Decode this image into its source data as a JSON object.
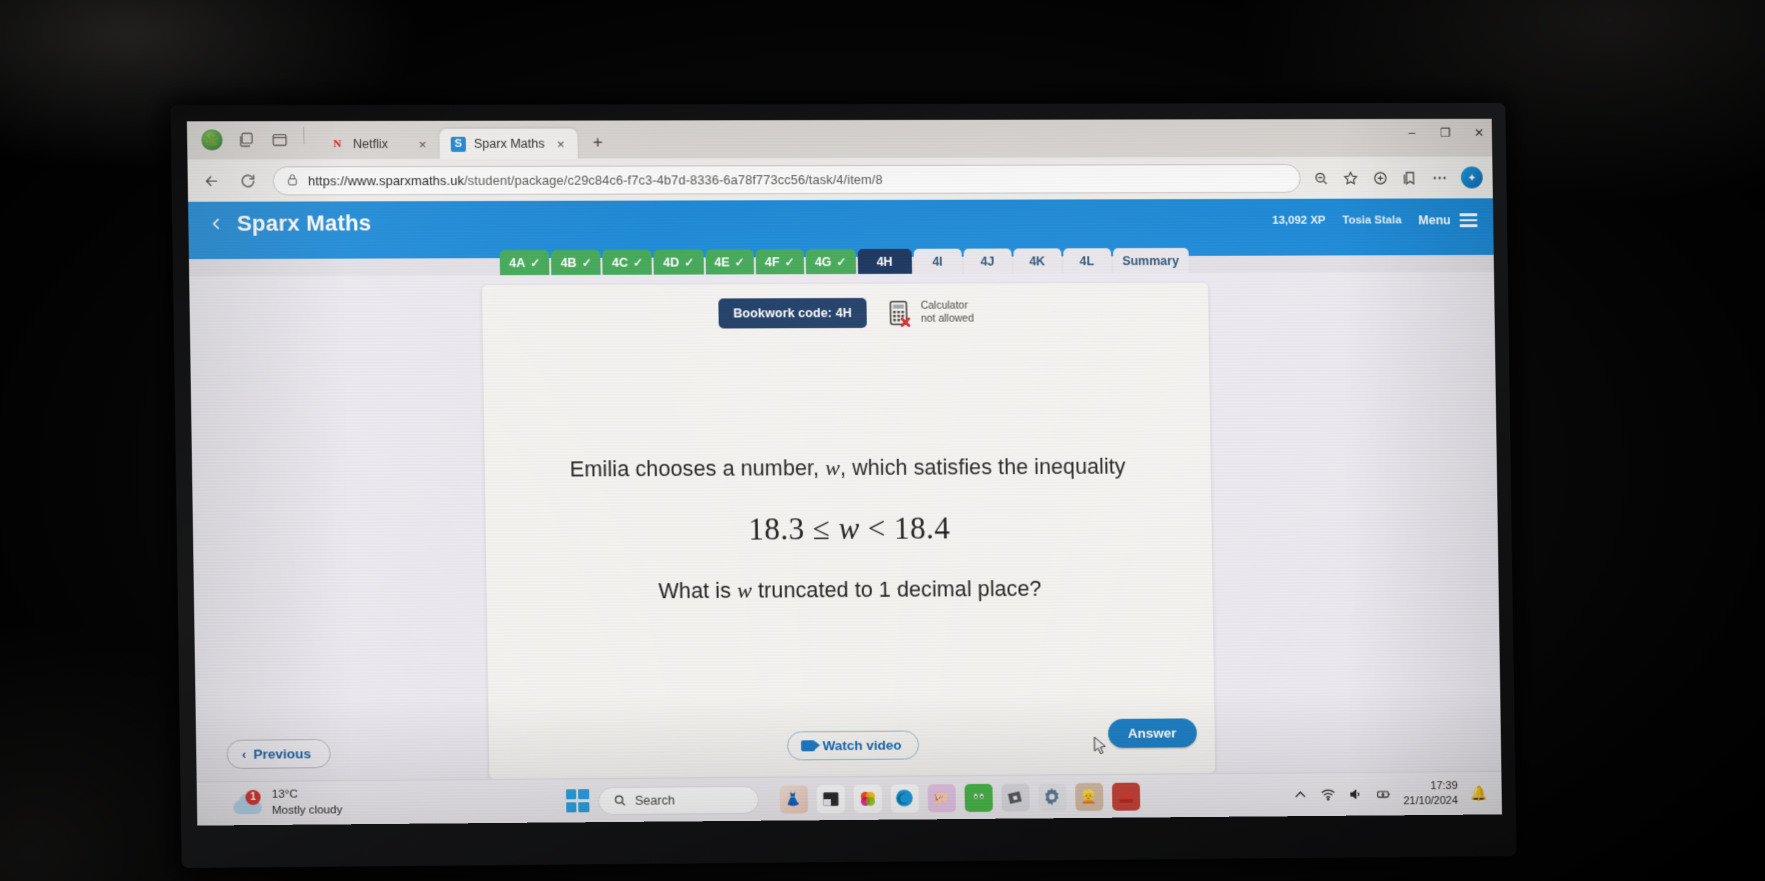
{
  "browser": {
    "tabs": [
      {
        "title": "Netflix",
        "favicon": "netflix-icon",
        "active": false,
        "close_label": "×"
      },
      {
        "title": "Sparx Maths",
        "favicon": "sparx-icon",
        "active": true,
        "close_label": "×"
      }
    ],
    "new_tab_label": "+",
    "window_controls": {
      "minimize": "–",
      "maximize": "❐",
      "close": "✕"
    },
    "address": {
      "protocol_host": "https://www.sparxmaths.uk",
      "path": "/student/package/c29c84c6-f7c3-4b7d-8336-6a78f773cc56/task/4/item/8",
      "full_url": "https://www.sparxmaths.uk/student/package/c29c84c6-f7c3-4b7d-8336-6a78f773cc56/task/4/item/8"
    },
    "toolbar_icons": [
      "back-icon",
      "reload-icon",
      "lock-icon",
      "zoom-out-icon",
      "favorite-star-icon",
      "collections-icon",
      "favorites-bar-icon",
      "settings-more-icon",
      "copilot-icon"
    ]
  },
  "sparx": {
    "header": {
      "title": "Sparx Maths",
      "back_icon": "chevron-left-icon",
      "xp": "13,092 XP",
      "user": "Tosia Stala",
      "menu_label": "Menu",
      "menu_icon": "hamburger-icon",
      "brand_color": "#1c8ad8"
    },
    "task_tabs": [
      {
        "label": "4A",
        "state": "done"
      },
      {
        "label": "4B",
        "state": "done"
      },
      {
        "label": "4C",
        "state": "done"
      },
      {
        "label": "4D",
        "state": "done"
      },
      {
        "label": "4E",
        "state": "done"
      },
      {
        "label": "4F",
        "state": "done"
      },
      {
        "label": "4G",
        "state": "done"
      },
      {
        "label": "4H",
        "state": "current"
      },
      {
        "label": "4I",
        "state": "todo"
      },
      {
        "label": "4J",
        "state": "todo"
      },
      {
        "label": "4K",
        "state": "todo"
      },
      {
        "label": "4L",
        "state": "todo"
      },
      {
        "label": "Summary",
        "state": "todo"
      }
    ],
    "tick_glyph": "✓",
    "card": {
      "bookwork_code": "Bookwork code: 4H",
      "calculator_icon": "calculator-not-allowed-icon",
      "calculator_line1": "Calculator",
      "calculator_line2": "not allowed",
      "question_line1_before": "Emilia chooses a number, ",
      "question_line1_var": "w",
      "question_line1_after": ", which satisfies the inequality",
      "math_left": "18.3 ≤ ",
      "math_var": "w",
      "math_right": " < 18.4",
      "question_line2_before": "What is ",
      "question_line2_var": "w",
      "question_line2_after": " truncated to 1 decimal place?",
      "watch_video_label": "Watch video",
      "watch_video_icon": "video-camera-icon",
      "answer_label": "Answer",
      "previous_label": "Previous",
      "previous_icon": "chevron-left-icon"
    }
  },
  "taskbar": {
    "weather": {
      "temperature": "13°C",
      "condition": "Mostly cloudy",
      "badge": "1",
      "icon": "cloud-icon"
    },
    "start_icon": "windows-start-icon",
    "search_placeholder": "Search",
    "search_icon": "search-icon",
    "apps": [
      {
        "name": "clothes-app-icon",
        "glyph": "👗"
      },
      {
        "name": "file-explorer-icon",
        "glyph": ""
      },
      {
        "name": "office-icon",
        "glyph": ""
      },
      {
        "name": "edge-browser-icon",
        "glyph": ""
      },
      {
        "name": "pink-game-icon",
        "glyph": ""
      },
      {
        "name": "green-face-icon",
        "glyph": ""
      },
      {
        "name": "roblox-icon",
        "glyph": ""
      },
      {
        "name": "settings-gear-icon",
        "glyph": ""
      },
      {
        "name": "photos-icon",
        "glyph": ""
      },
      {
        "name": "red-app-icon",
        "glyph": ""
      }
    ],
    "tray_icons": [
      "chevron-up-icon",
      "wifi-icon",
      "volume-icon",
      "battery-icon"
    ],
    "time": "17:39",
    "date": "21/10/2024",
    "notification_icon": "bell-icon"
  }
}
